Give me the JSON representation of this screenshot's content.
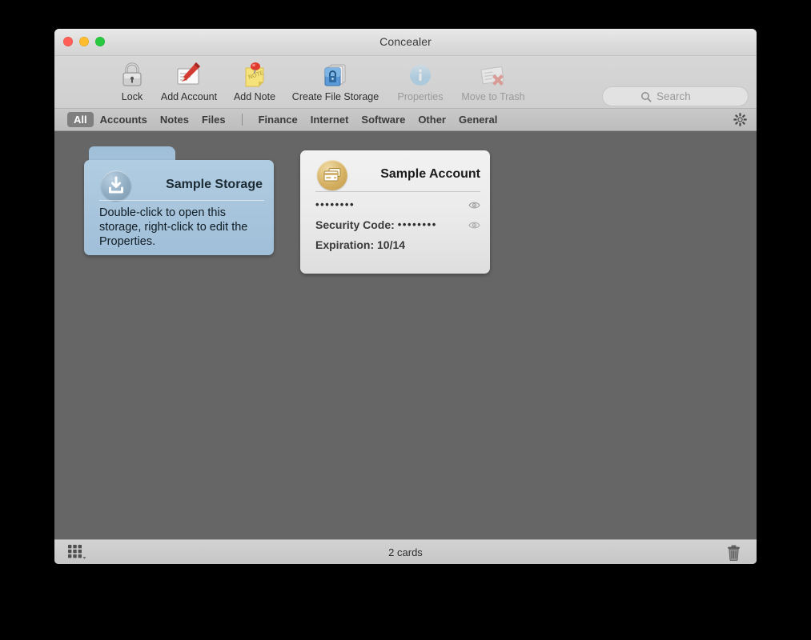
{
  "window": {
    "title": "Concealer",
    "traffic_lights": {
      "close": "close-button",
      "minimize": "minimize-button",
      "maximize": "maximize-button"
    }
  },
  "toolbar": {
    "items": [
      {
        "id": "lock",
        "label": "Lock",
        "icon": "padlock-icon",
        "disabled": false
      },
      {
        "id": "add-account",
        "label": "Add Account",
        "icon": "add-account-icon",
        "disabled": false
      },
      {
        "id": "add-note",
        "label": "Add Note",
        "icon": "sticky-note-icon",
        "disabled": false
      },
      {
        "id": "create-file-storage",
        "label": "Create File Storage",
        "icon": "file-storage-icon",
        "disabled": false
      },
      {
        "id": "properties",
        "label": "Properties",
        "icon": "info-icon",
        "disabled": true
      },
      {
        "id": "move-to-trash",
        "label": "Move to Trash",
        "icon": "delete-card-icon",
        "disabled": true
      }
    ],
    "search": {
      "placeholder": "Search",
      "value": "",
      "caption": "Search",
      "icon": "search-icon"
    }
  },
  "filter_bar": {
    "groups": [
      [
        "All",
        "Accounts",
        "Notes",
        "Files"
      ],
      [
        "Finance",
        "Internet",
        "Software",
        "Other",
        "General"
      ]
    ],
    "active": "All",
    "settings_icon": "gear-icon"
  },
  "cards": {
    "storage": {
      "title": "Sample Storage",
      "description": "Double-click to open this storage, right-click to edit the Properties.",
      "icon": "storage-download-icon",
      "color": "#a9c6dd"
    },
    "account": {
      "title": "Sample Account",
      "icon": "credit-card-icon",
      "color": "#d6b163",
      "fields": [
        {
          "id": "password",
          "label": "",
          "value": "••••••••",
          "reveal_icon": "eye-icon",
          "revealable": true
        },
        {
          "id": "security",
          "label": "Security Code: ",
          "value": "••••••••",
          "reveal_icon": "eye-icon",
          "revealable": true
        },
        {
          "id": "expiration",
          "label": "Expiration: ",
          "value": "10/14",
          "reveal_icon": "",
          "revealable": false
        }
      ]
    }
  },
  "status_bar": {
    "view_mode_icon": "grid-view-icon",
    "count_text": "2 cards",
    "trash_icon": "trash-icon"
  }
}
